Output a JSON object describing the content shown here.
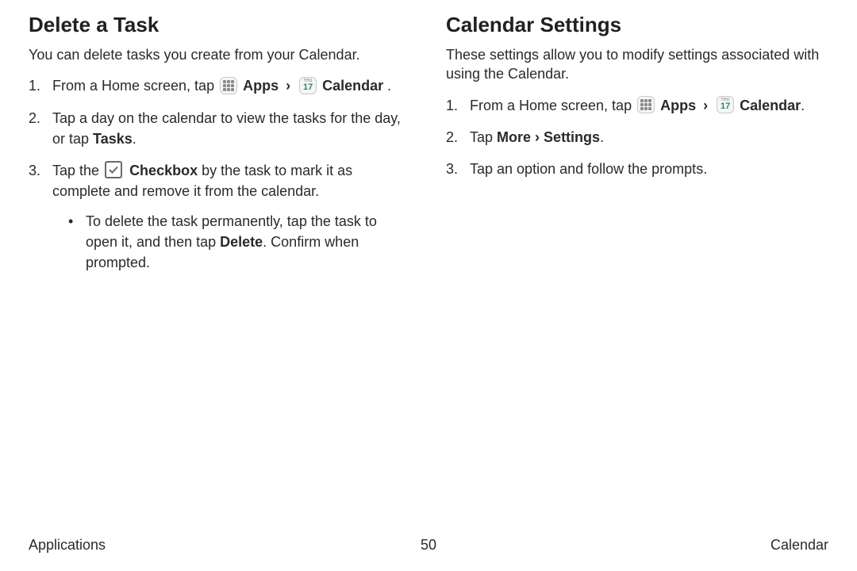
{
  "left": {
    "heading": "Delete a Task",
    "intro": "You can delete tasks you create from your Calendar.",
    "step1_prefix": "From a Home screen, tap ",
    "apps_label": "Apps",
    "sep": "›",
    "calendar_label": "Calendar",
    "step1_suffix": " .",
    "step2a": "Tap a day on the calendar to view the tasks for the day, or tap ",
    "step2b": "Tasks",
    "step2c": ".",
    "step3a": "Tap the ",
    "step3b": "Checkbox",
    "step3c": " by the task to mark it as complete and remove it from the calendar.",
    "bullet_a": "To delete the task permanently, tap the task to open it, and then tap ",
    "bullet_b": "Delete",
    "bullet_c": ". Confirm when prompted."
  },
  "right": {
    "heading": "Calendar Settings",
    "intro": "These settings allow you to modify settings associated with using the Calendar.",
    "step1_prefix": "From a Home screen, tap ",
    "apps_label": "Apps",
    "sep": "›",
    "calendar_label": "Calendar",
    "step1_suffix": ".",
    "step2a": "Tap ",
    "step2b": "More",
    "step2sep": " › ",
    "step2c": "Settings",
    "step2d": ".",
    "step3": "Tap an option and follow the prompts."
  },
  "icons": {
    "cal_dow": "THU",
    "cal_num": "17"
  },
  "footer": {
    "left": "Applications",
    "page": "50",
    "right": "Calendar"
  }
}
